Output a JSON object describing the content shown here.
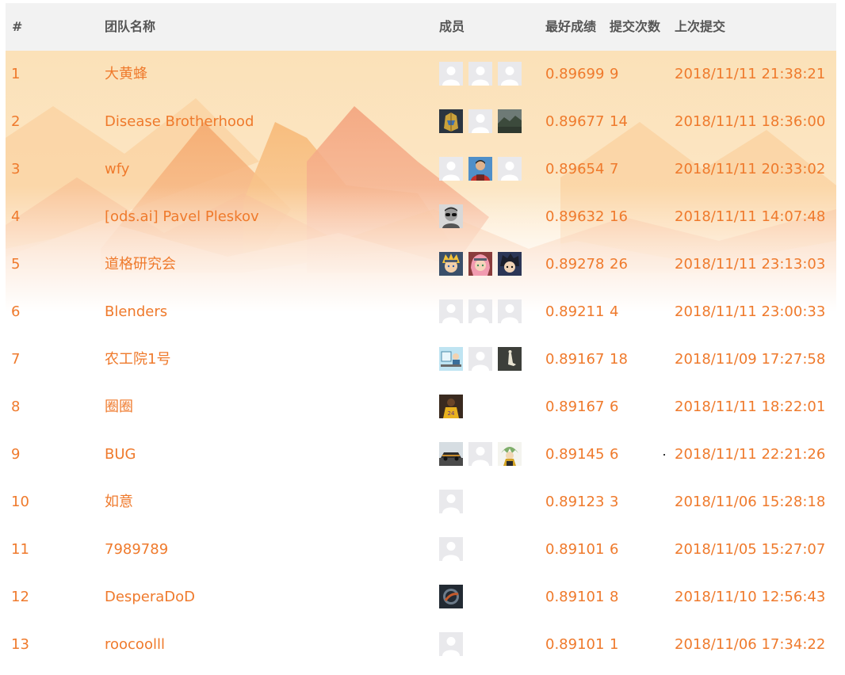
{
  "header": {
    "rank": "#",
    "team": "团队名称",
    "members": "成员",
    "best": "最好成绩",
    "submissions": "提交次数",
    "last": "上次提交"
  },
  "colors": {
    "accent": "#ef7a2c",
    "header_bg": "#f2f2f2",
    "header_text": "#555555"
  },
  "rows": [
    {
      "rank": "1",
      "team": "大黄蜂",
      "avatars": [
        "default-avatar",
        "default-avatar",
        "default-avatar"
      ],
      "score": "0.89699",
      "count": "9",
      "time": "2018/11/11 21:38:21"
    },
    {
      "rank": "2",
      "team": "Disease Brotherhood",
      "avatars": [
        "helmet-avatar",
        "default-avatar",
        "landscape-avatar"
      ],
      "score": "0.89677",
      "count": "14",
      "time": "2018/11/11 18:36:00"
    },
    {
      "rank": "3",
      "team": "wfy",
      "avatars": [
        "default-avatar",
        "person-avatar",
        "default-avatar"
      ],
      "score": "0.89654",
      "count": "7",
      "time": "2018/11/11 20:33:02"
    },
    {
      "rank": "4",
      "team": "[ods.ai] Pavel Pleskov",
      "avatars": [
        "sunglasses-avatar"
      ],
      "score": "0.89632",
      "count": "16",
      "time": "2018/11/11 14:07:48"
    },
    {
      "rank": "5",
      "team": "道格研究会",
      "avatars": [
        "anime-blond-avatar",
        "anime-pink-avatar",
        "anime-dark-avatar"
      ],
      "score": "0.89278",
      "count": "26",
      "time": "2018/11/11 23:13:03"
    },
    {
      "rank": "6",
      "team": "Blenders",
      "avatars": [
        "default-avatar",
        "default-avatar",
        "default-avatar"
      ],
      "score": "0.89211",
      "count": "4",
      "time": "2018/11/11 23:00:33"
    },
    {
      "rank": "7",
      "team": "农工院1号",
      "avatars": [
        "cartoon-desk-avatar",
        "default-avatar",
        "dark-figure-avatar"
      ],
      "score": "0.89167",
      "count": "18",
      "time": "2018/11/09 17:27:58"
    },
    {
      "rank": "8",
      "team": "圈圈",
      "avatars": [
        "basketball-avatar"
      ],
      "score": "0.89167",
      "count": "6",
      "time": "2018/11/11 18:22:01"
    },
    {
      "rank": "9",
      "team": "BUG",
      "avatars": [
        "car-avatar",
        "default-avatar",
        "anime-green-avatar"
      ],
      "score": "0.89145",
      "count": "6",
      "time": "2018/11/11 22:21:26"
    },
    {
      "rank": "10",
      "team": "如意",
      "avatars": [
        "default-avatar"
      ],
      "score": "0.89123",
      "count": "3",
      "time": "2018/11/06 15:28:18"
    },
    {
      "rank": "11",
      "team": "7989789",
      "avatars": [
        "default-avatar"
      ],
      "score": "0.89101",
      "count": "6",
      "time": "2018/11/05 15:27:07"
    },
    {
      "rank": "12",
      "team": "DesperaDoD",
      "avatars": [
        "dark-logo-avatar"
      ],
      "score": "0.89101",
      "count": "8",
      "time": "2018/11/10 12:56:43"
    },
    {
      "rank": "13",
      "team": "roocoolll",
      "avatars": [
        "default-avatar"
      ],
      "score": "0.89101",
      "count": "1",
      "time": "2018/11/06 17:34:22"
    }
  ]
}
